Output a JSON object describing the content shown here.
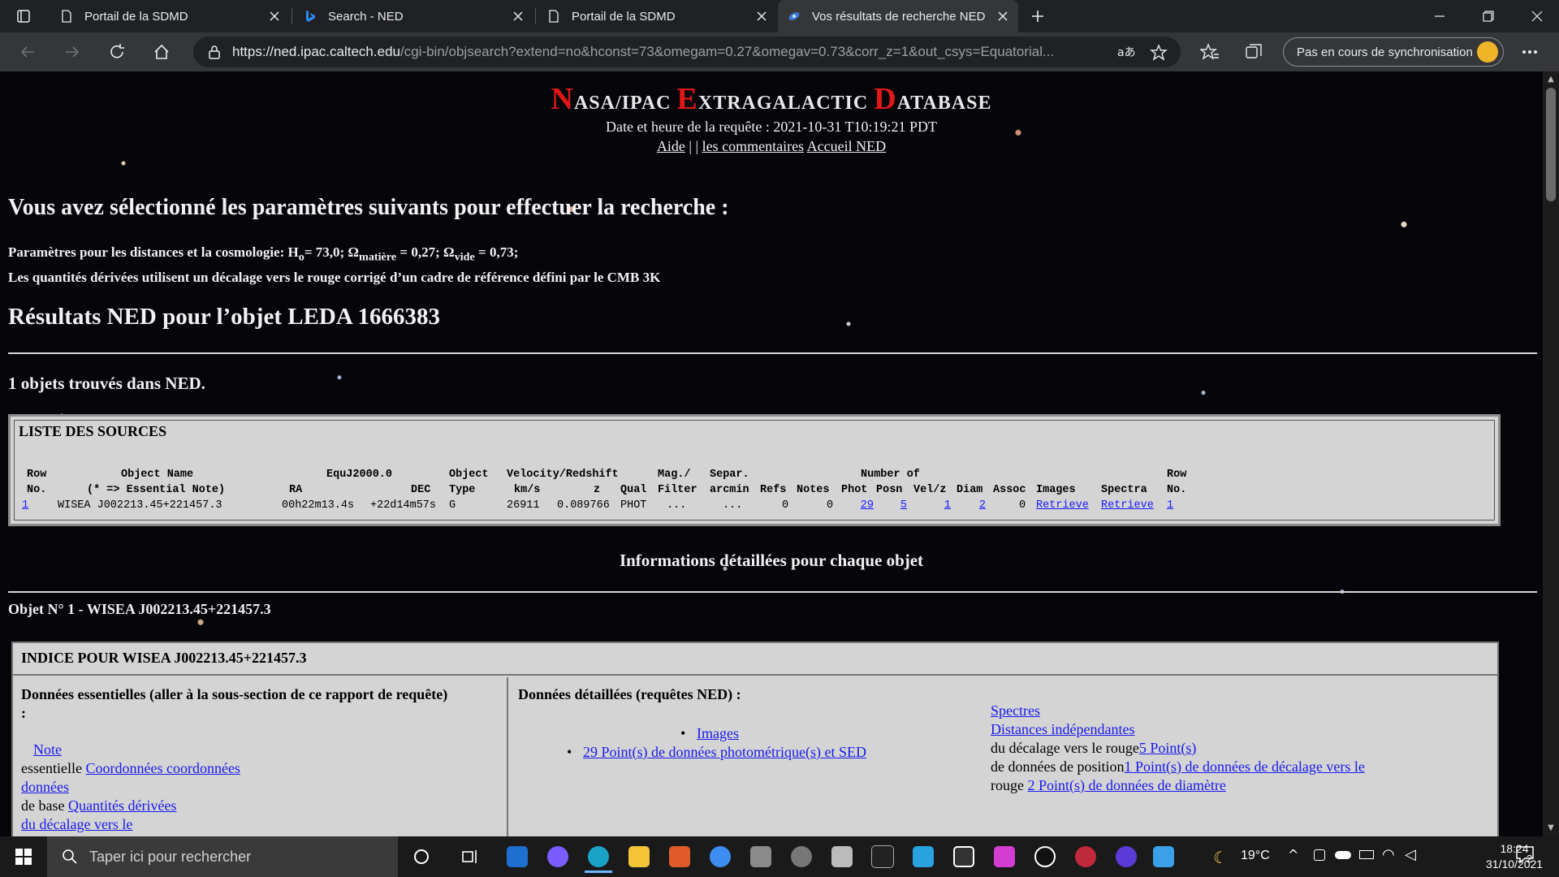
{
  "browser": {
    "tabs": [
      {
        "label": "Portail de la SDMD",
        "icon": "document-icon"
      },
      {
        "label": "Search - NED",
        "icon": "bing-icon"
      },
      {
        "label": "Portail de la SDMD",
        "icon": "document-icon"
      },
      {
        "label": "Vos résultats de recherche NED",
        "icon": "ned-galaxy-icon",
        "active": true
      }
    ],
    "url_host": "https://ned.ipac.caltech.edu",
    "url_rest": "/cgi-bin/objsearch?extend=no&hconst=73&omegam=0.27&omegav=0.73&corr_z=1&out_csys=Equatorial...",
    "sync_label": "Pas en cours de synchronisation"
  },
  "page": {
    "ned_title": {
      "n": "N",
      "asa": "ASA/IPAC ",
      "e": "E",
      "xtra": "XTRAGALACTIC ",
      "d": "D",
      "atabase": "ATABASE"
    },
    "request_date": "Date et heure de la requête : 2021-10-31 T10:19:21 PDT",
    "links": {
      "help": "Aide",
      "sep1": " | ",
      "sep2": "| ",
      "comments": "les commentaires",
      "home": "Accueil NED"
    },
    "selected_params_heading": "Vous avez sélectionné les paramètres suivants pour effectuer la recherche :",
    "cosmo": {
      "prefix": "Paramètres pour les distances et la cosmologie: H",
      "h_sub": "o",
      "h_val": "= 73,0; Ω",
      "m_sub": "matière",
      "m_val": " = 0,27; Ω",
      "v_sub": "vide",
      "v_val": " = 0,73;",
      "line2": "Les quantités dérivées utilisent un décalage vers le rouge corrigé d’un cadre de référence défini par le CMB 3K"
    },
    "results_heading": "Résultats NED pour l’objet LEDA 1666383",
    "objects_found": "1 objets trouvés dans NED.",
    "source_list": {
      "title": "LISTE DES SOURCES",
      "header1": {
        "row": "Row",
        "object_name": "Object Name",
        "equ": "EquJ2000.0",
        "object": "Object",
        "velocity": "Velocity/Redshift",
        "mag": "Mag./",
        "separ": "Separ.",
        "number_of": "Number of",
        "row2": "Row"
      },
      "header2": {
        "no": "No.",
        "essential": "(* => Essential Note)",
        "ra": "RA",
        "dec": "DEC",
        "type": "Type",
        "kms": "km/s",
        "z": "z",
        "qual": "Qual",
        "filter": "Filter",
        "arcmin": "arcmin",
        "refs": "Refs",
        "notes": "Notes",
        "phot": "Phot",
        "posn": "Posn",
        "velz": "Vel/z",
        "diam": "Diam",
        "assoc": "Assoc",
        "images": "Images",
        "spectra": "Spectra",
        "no2": "No."
      },
      "row": {
        "no": "1",
        "name": "WISEA J002213.45+221457.3",
        "ra": "00h22m13.4s",
        "dec": "+22d14m57s",
        "type": "G",
        "velocity": "26911",
        "z": "0.089766",
        "qual": "PHOT",
        "mag": "...",
        "separ": "...",
        "refs": "0",
        "notes": "0",
        "phot": "29",
        "posn": "5",
        "velz": "1",
        "diam": "2",
        "assoc": "0",
        "images": "Retrieve",
        "spectra": "Retrieve",
        "no2": "1"
      }
    },
    "detailed_heading": "Informations détaillées pour chaque objet",
    "object_heading": "Objet N° 1 - WISEA J002213.45+221457.3",
    "index": {
      "title": "INDICE POUR WISEA J002213.45+221457.3",
      "essential_heading": "Données essentielles (aller à la sous-section de ce rapport de requête)",
      "essential_colon": ":",
      "note_link": "Note",
      "essentielle": "essentielle ",
      "coords_link": "Coordonnées coordonnées",
      "donnees_link": "données",
      "de_base": "de base ",
      "derived_link": "Quantités dérivées",
      "decalage_link": "du décalage vers le",
      "detailed_heading": "Données détaillées (requêtes NED) :",
      "images_link": "Images",
      "photometry_link": "29 Point(s) de données photométrique(s) et SED",
      "spectra_link": "Spectres",
      "distances_link": "Distances indépendantes",
      "redshift_text": "du décalage vers le rouge",
      "redshift_link": "5 Point(s)",
      "position_text": "de données de position",
      "position_link": "1 Point(s) de données de décalage vers le",
      "rouge_text": "rouge ",
      "diameter_link": "2 Point(s) de données de diamètre"
    }
  },
  "taskbar": {
    "search_placeholder": "Taper ici pour rechercher",
    "temperature": "19°C",
    "time": "18:24",
    "date": "31/10/2021",
    "notifications": "2"
  }
}
